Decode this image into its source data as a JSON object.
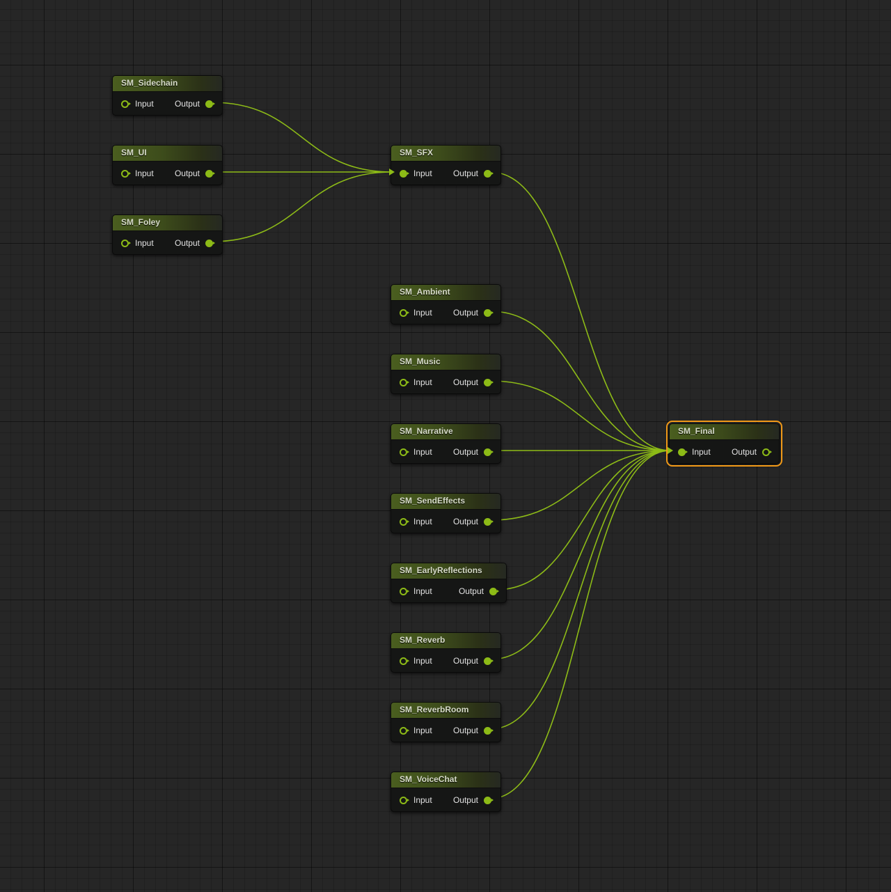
{
  "graph": {
    "accent_color": "#8dbb17",
    "selection_color": "#f29a18",
    "header_color": "#4a5e1f",
    "nodes": [
      {
        "id": "sidechain",
        "title": "SM_Sidechain",
        "input_label": "Input",
        "output_label": "Output",
        "input_connected": false,
        "output_connected": true,
        "selected": false
      },
      {
        "id": "ui",
        "title": "SM_UI",
        "input_label": "Input",
        "output_label": "Output",
        "input_connected": false,
        "output_connected": true,
        "selected": false
      },
      {
        "id": "foley",
        "title": "SM_Foley",
        "input_label": "Input",
        "output_label": "Output",
        "input_connected": false,
        "output_connected": true,
        "selected": false
      },
      {
        "id": "sfx",
        "title": "SM_SFX",
        "input_label": "Input",
        "output_label": "Output",
        "input_connected": true,
        "output_connected": true,
        "selected": false
      },
      {
        "id": "ambient",
        "title": "SM_Ambient",
        "input_label": "Input",
        "output_label": "Output",
        "input_connected": false,
        "output_connected": true,
        "selected": false
      },
      {
        "id": "music",
        "title": "SM_Music",
        "input_label": "Input",
        "output_label": "Output",
        "input_connected": false,
        "output_connected": true,
        "selected": false
      },
      {
        "id": "narrative",
        "title": "SM_Narrative",
        "input_label": "Input",
        "output_label": "Output",
        "input_connected": false,
        "output_connected": true,
        "selected": false
      },
      {
        "id": "sendeffects",
        "title": "SM_SendEffects",
        "input_label": "Input",
        "output_label": "Output",
        "input_connected": false,
        "output_connected": true,
        "selected": false
      },
      {
        "id": "earlyreflections",
        "title": "SM_EarlyReflections",
        "input_label": "Input",
        "output_label": "Output",
        "input_connected": false,
        "output_connected": true,
        "selected": false
      },
      {
        "id": "reverb",
        "title": "SM_Reverb",
        "input_label": "Input",
        "output_label": "Output",
        "input_connected": false,
        "output_connected": true,
        "selected": false
      },
      {
        "id": "reverbroom",
        "title": "SM_ReverbRoom",
        "input_label": "Input",
        "output_label": "Output",
        "input_connected": false,
        "output_connected": true,
        "selected": false
      },
      {
        "id": "voicechat",
        "title": "SM_VoiceChat",
        "input_label": "Input",
        "output_label": "Output",
        "input_connected": false,
        "output_connected": true,
        "selected": false
      },
      {
        "id": "final",
        "title": "SM_Final",
        "input_label": "Input",
        "output_label": "Output",
        "input_connected": true,
        "output_connected": false,
        "selected": true
      }
    ],
    "connections": [
      {
        "from": "sidechain",
        "to": "sfx"
      },
      {
        "from": "ui",
        "to": "sfx"
      },
      {
        "from": "foley",
        "to": "sfx"
      },
      {
        "from": "sfx",
        "to": "final"
      },
      {
        "from": "ambient",
        "to": "final"
      },
      {
        "from": "music",
        "to": "final"
      },
      {
        "from": "narrative",
        "to": "final"
      },
      {
        "from": "sendeffects",
        "to": "final"
      },
      {
        "from": "earlyreflections",
        "to": "final"
      },
      {
        "from": "reverb",
        "to": "final"
      },
      {
        "from": "reverbroom",
        "to": "final"
      },
      {
        "from": "voicechat",
        "to": "final"
      }
    ]
  }
}
